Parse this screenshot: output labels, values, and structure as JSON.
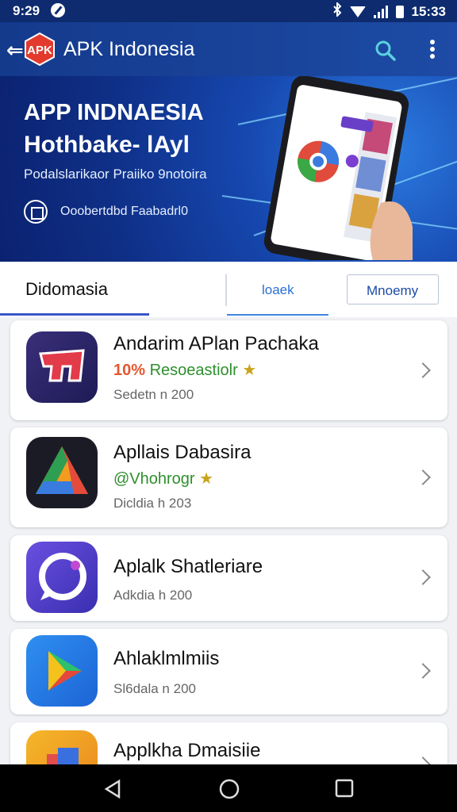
{
  "status_bar": {
    "time_left": "9:29",
    "time_right": "15:33"
  },
  "app_bar": {
    "logo_text": "APK",
    "title": "APK Indonesia"
  },
  "banner": {
    "title": "APP INDNAESIA",
    "subtitle": "Hothbake- lAyl",
    "description": "Podalslarikaor Praiiko 9notoira",
    "badge": "Ooobertdbd Faabadrl0"
  },
  "tabs": {
    "primary": "Didomasia",
    "secondary": "loaek",
    "button": "Mnoemy"
  },
  "apps": [
    {
      "name": "Andarim APlan Pachaka",
      "tag": "10% Resoeastiolr",
      "tag_color": "#2e8f2e",
      "tag_prefix_color": "#e4572e",
      "date": "Sedetn n 200",
      "icon": "pp-icon"
    },
    {
      "name": "Apllais Dabasira",
      "tag": "@Vhohrogr",
      "tag_color": "#2e8f2e",
      "date": "Dicldia h 203",
      "icon": "drive-icon"
    },
    {
      "name": "Aplalk Shatleriare",
      "tag": "",
      "date": "Adkdia h 200",
      "icon": "chat-icon"
    },
    {
      "name": "Ahlaklmlmiis",
      "tag": "",
      "date": "Sl6dala n 200",
      "icon": "play-icon"
    },
    {
      "name": "Applkha Dmaisiie",
      "tag": "",
      "date": "",
      "icon": "photos-icon"
    }
  ],
  "colors": {
    "primary": "#1d4ba5",
    "accent": "#3a55c8"
  }
}
